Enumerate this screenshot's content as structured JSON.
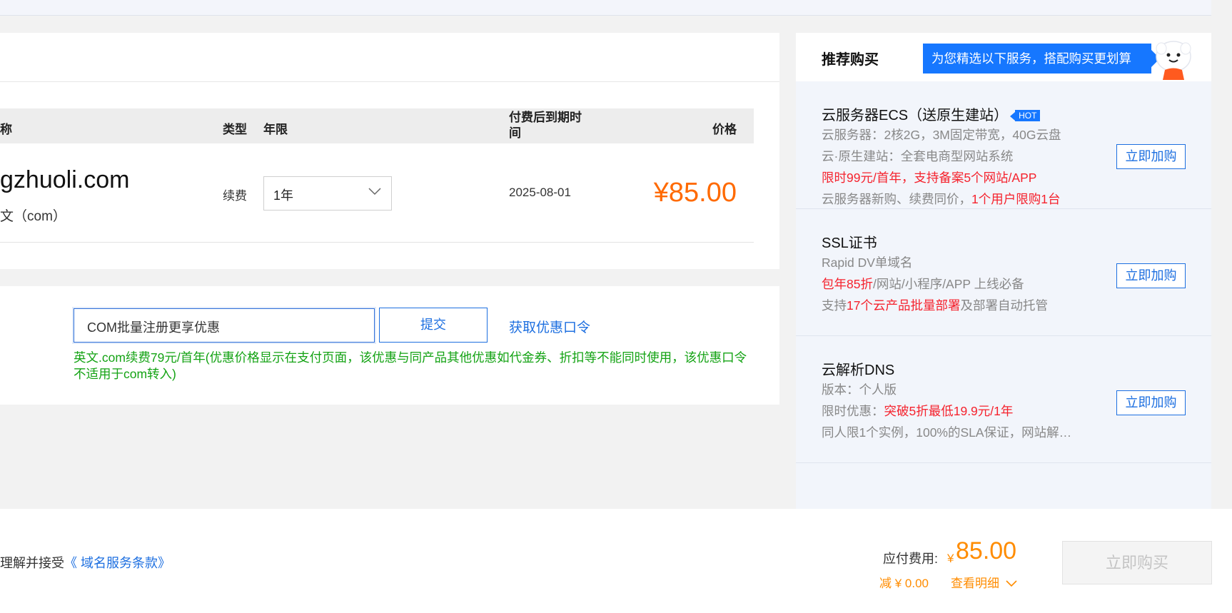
{
  "table": {
    "headers": {
      "name": "称",
      "type": "类型",
      "years": "年限",
      "expiry": "付费后到期时间",
      "price": "价格"
    },
    "row": {
      "domain": "gzhuoli.com",
      "domain_sub": "文（com）",
      "type": "续费",
      "years_selected": "1年",
      "expiry": "2025-08-01",
      "price": "¥85.00"
    }
  },
  "coupon": {
    "input_value": "COM批量注册更享优惠",
    "submit_label": "提交",
    "get_code_link": "获取优惠口令",
    "note": "英文.com续费79元/首年(优惠价格显示在支付页面，该优惠与同产品其他优惠如代金券、折扣等不能同时使用，该优惠口令不适用于com转入)"
  },
  "recommend": {
    "title": "推荐购买",
    "banner": "为您精选以下服务，搭配购买更划算",
    "items": [
      {
        "title": "云服务器ECS（送原生建站）",
        "badge": "HOT",
        "lines": [
          [
            "云服务器：2核2G，3M固定带宽，40G云盘"
          ],
          [
            "云·原生建站：全套电商型网站系统"
          ],
          [
            "限时99元/首年，支持",
            "备案5个网站/APP"
          ],
          [
            "云服务器新购、续费同价，",
            "1个用户限购1台"
          ]
        ],
        "button": "立即加购"
      },
      {
        "title": "SSL证书",
        "lines": [
          [
            "Rapid DV单域名"
          ],
          [
            "包年85折",
            "/网站/小程序/APP 上线必备"
          ],
          [
            "支持",
            "17个云产品批量部署",
            "及部署自动托管"
          ]
        ],
        "button": "立即加购"
      },
      {
        "title": "云解析DNS",
        "lines": [
          [
            "版本：个人版"
          ],
          [
            "限时优惠：",
            "突破5折最低19.9元/1年"
          ],
          [
            "同人限1个实例，100%的SLA保证，网站解…"
          ]
        ],
        "button": "立即加购"
      }
    ]
  },
  "footer": {
    "agree_text": "理解并接受",
    "terms_link": "《 域名服务条款》",
    "pay_label": "应付费用:",
    "currency": "¥",
    "pay_amount": "85.00",
    "discount": "减 ¥ 0.00",
    "detail_link": "查看明细",
    "buy_button": "立即购买"
  },
  "colors": {
    "accent": "#1d6fe0",
    "price": "#ff6a00",
    "note_green": "#14a314",
    "promo_red": "#f5222d"
  }
}
